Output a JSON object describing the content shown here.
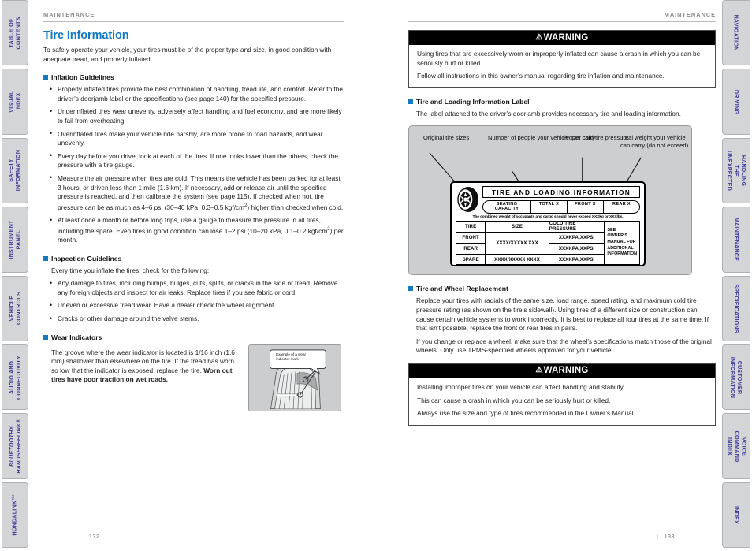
{
  "sidebar_left": {
    "tabs": [
      {
        "label": "TABLE OF CONTENTS",
        "italic": false
      },
      {
        "label": "VISUAL INDEX",
        "italic": false
      },
      {
        "label": "SAFETY\nINFORMATION",
        "italic": false
      },
      {
        "label": "INSTRUMENT PANEL",
        "italic": false
      },
      {
        "label": "VEHICLE\nCONTROLS",
        "italic": false
      },
      {
        "label": "AUDIO AND\nCONNECTIVITY",
        "italic": false
      },
      {
        "label": "BLUETOOTH®\nHANDSFREELINK®",
        "italic": true
      },
      {
        "label": "HONDALINK™",
        "italic": false
      }
    ]
  },
  "sidebar_right": {
    "tabs": [
      {
        "label": "NAVIGATION"
      },
      {
        "label": "DRIVING"
      },
      {
        "label": "HANDLING THE\nUNEXPECTED"
      },
      {
        "label": "MAINTENANCE"
      },
      {
        "label": "SPECIFICATIONS"
      },
      {
        "label": "CUSTOMER\nINFORMATION"
      },
      {
        "label": "VOICE COMMAND\nINDEX"
      },
      {
        "label": "INDEX"
      }
    ]
  },
  "accent_color": "#1479bd",
  "left_page": {
    "header": "MAINTENANCE",
    "title": "Tire Information",
    "intro": "To safely operate your vehicle, your tires must be of the proper type and size, in good condition with adequate tread, and properly inflated.",
    "inflation": {
      "heading": "Inflation Guidelines",
      "items": [
        "Properly inflated tires provide the best combination of handling, tread life, and comfort. Refer to the driver’s doorjamb label or the specifications (see page 140) for the specified pressure.",
        "Underinflated tires wear unevenly, adversely affect handling and fuel economy, and are more likely to fail from overheating.",
        "Overinflated tires make your vehicle ride harshly, are more prone to road hazards, and wear unevenly.",
        "Every day before you drive, look at each of the tires. If one looks lower than the others, check the pressure with a tire gauge."
      ],
      "item_measure_a": "Measure the air pressure when tires are cold. This means the vehicle has been parked for at least 3 hours, or driven less than 1 mile (1.6 km). If necessary, add or release air until the specified pressure is reached, and then calibrate the system (see page 115). If checked when hot, tire pressure can be as much as 4–6 psi (30–40 kPa, 0.3–0.5 kgf/cm",
      "item_measure_sup": "2",
      "item_measure_b": ") higher than checked when cold.",
      "item_month_a": "At least once a month or before long trips, use a gauge to measure the pressure in all tires, including the spare. Even tires in good condition can lose 1–2 psi (10–20 kPa, 0.1–0.2 kgf/cm",
      "item_month_sup": "2",
      "item_month_b": ") per month."
    },
    "inspection": {
      "heading": "Inspection Guidelines",
      "lead": "Every time you inflate the tires, check for the following:",
      "items": [
        "Any damage to tires, including bumps, bulges, cuts, splits, or cracks in the side or tread. Remove any foreign objects and inspect for air leaks. Replace tires if you see fabric or cord.",
        "Uneven or excessive tread wear. Have a dealer check the wheel alignment.",
        "Cracks or other damage around the valve stems."
      ]
    },
    "wear": {
      "heading": "Wear Indicators",
      "text_a": "The groove where the wear indicator is located is 1/16 inch (1.6 mm) shallower than elsewhere on the tire. If the tread has worn so low that the indicator is exposed, replace the tire. ",
      "text_bold": "Worn out tires have poor traction on wet roads.",
      "figure_callout": "Example of a wear indicator mark"
    },
    "page_number": "132"
  },
  "right_page": {
    "header": "MAINTENANCE",
    "warning_top": {
      "title": "WARNING",
      "triangle": "warning-triangle-icon",
      "paragraphs": [
        "Using tires that are excessively worn or improperly inflated can cause a crash in which you can be seriously hurt or killed.",
        "Follow all instructions in this owner’s manual regarding tire inflation and maintenance."
      ]
    },
    "loading_label": {
      "heading": "Tire and Loading Information Label",
      "text": "The label attached to the driver’s doorjamb provides necessary tire and loading information.",
      "callouts": [
        "Original\ntire sizes",
        "Number of\npeople your\nvehicle can\ncarry",
        "Proper cold\ntire pressure",
        "Total weight\nyour vehicle\ncan carry\n(do not exceed)"
      ],
      "label_card": {
        "title": "TIRE AND LOADING INFORMATION",
        "seating_capacity": "SEATING CAPACITY",
        "seat_total": "TOTAL X",
        "seat_front": "FRONT X",
        "seat_rear": "REAR X",
        "note": "The combined weight of occupants and cargo should never exceed XXXkg or XXXlbs.",
        "columns": [
          "TIRE",
          "SIZE",
          "COLD TIRE PRESSURE"
        ],
        "rows": [
          {
            "tire": "FRONT",
            "size": "XXXX/XXXXX XXX",
            "pressure": "XXXKPA,XXPSI"
          },
          {
            "tire": "REAR",
            "size": "XXXX/XXXXX XXX",
            "pressure": "XXXKPA,XXPSI"
          },
          {
            "tire": "SPARE",
            "size": "XXXX/XXXXX XXXX",
            "pressure": "XXXKPA,XXPSI"
          }
        ],
        "side_note": "SEE OWNER'S MANUAL FOR ADDITIONAL INFORMATION"
      }
    },
    "replacement": {
      "heading": "Tire and Wheel Replacement",
      "paragraphs": [
        "Replace your tires with radials of the same size, load range, speed rating, and maximum cold tire pressure rating (as shown on the tire’s sidewall). Using tires of a different size or construction can cause certain vehicle systems to work incorrectly. It is best to replace all four tires at the same time. If that isn’t possible, replace the front or rear tires in pairs.",
        "If you change or replace a wheel, make sure that the wheel’s specifications match those of the original wheels. Only use TPMS-specified wheels approved for your vehicle."
      ]
    },
    "warning_bottom": {
      "title": "WARNING",
      "triangle": "warning-triangle-icon",
      "paragraphs": [
        "Installing improper tires on your vehicle can affect handling and stability.",
        "This can cause a crash in which you can be seriously hurt or killed.",
        "Always use the size and type of tires recommended in the Owner’s Manual."
      ]
    },
    "page_number": "133"
  }
}
